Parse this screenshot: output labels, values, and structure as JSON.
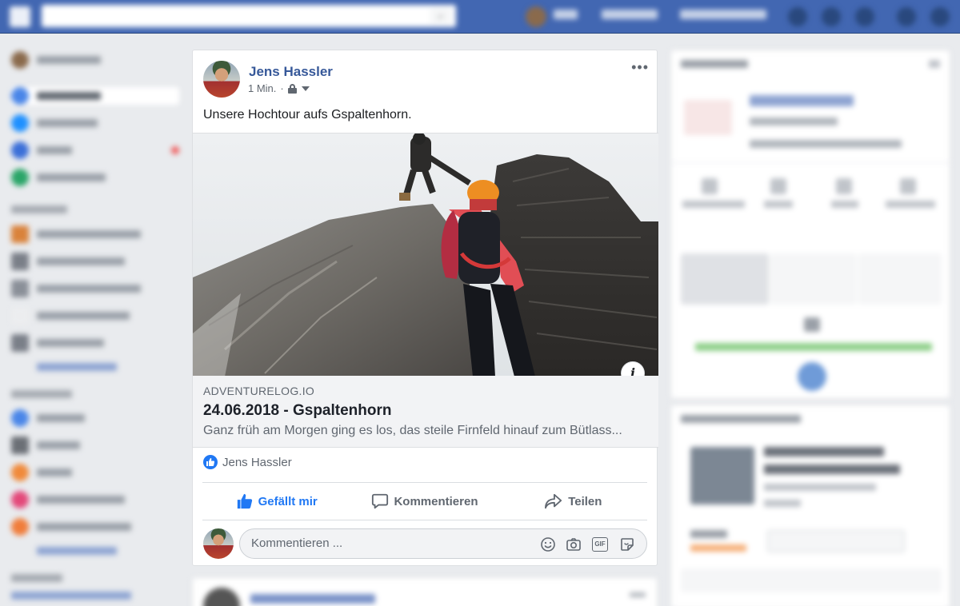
{
  "post": {
    "author": "Jens Hassler",
    "time": "1 Min.",
    "separator": "·",
    "more": "•••",
    "text": "Unsere Hochtour aufs Gspaltenhorn.",
    "info": "i",
    "link": {
      "domain": "ADVENTURELOG.IO",
      "title": "24.06.2018 - Gspaltenhorn",
      "description": "Ganz früh am Morgen ging es los, das steile Firnfeld hinauf zum Bütlass..."
    },
    "reactions": {
      "names": "Jens Hassler"
    },
    "actions": {
      "like": "Gefällt mir",
      "comment": "Kommentieren",
      "share": "Teilen"
    },
    "comment_placeholder": "Kommentieren ...",
    "gif": "GIF"
  },
  "icons": {
    "more": "more-icon",
    "lock": "lock-icon",
    "audience": "caret-down-icon",
    "info": "info-icon",
    "like": "thumbs-up-icon",
    "comment": "comment-bubble-icon",
    "share": "share-arrow-icon",
    "emoji": "emoji-icon",
    "camera": "camera-icon",
    "gif": "gif-icon",
    "sticker": "sticker-icon"
  },
  "colors": {
    "topbar": "#4267b2",
    "author": "#365899",
    "like_active": "#2078f4",
    "page_bg": "#e9ebee"
  }
}
